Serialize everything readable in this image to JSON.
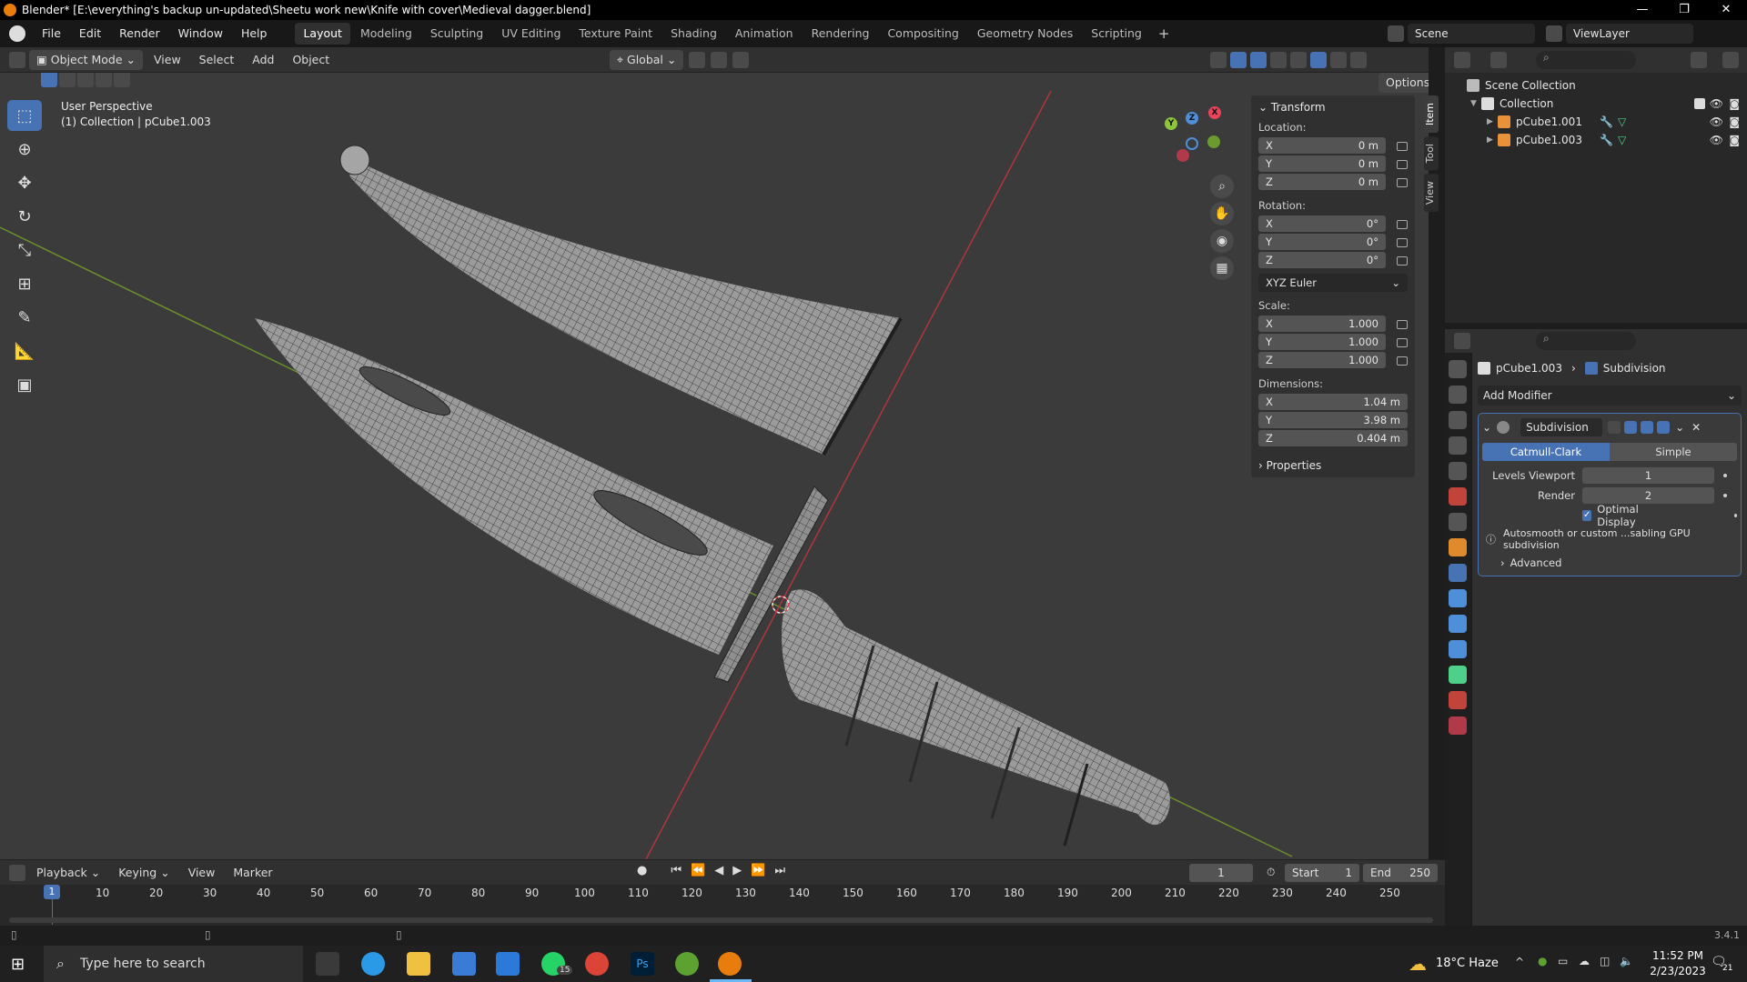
{
  "window": {
    "title": "Blender* [E:\\everything's backup un-updated\\Sheetu work new\\Knife with cover\\Medieval dagger.blend]"
  },
  "menu": [
    "File",
    "Edit",
    "Render",
    "Window",
    "Help"
  ],
  "workspaces": [
    "Layout",
    "Modeling",
    "Sculpting",
    "UV Editing",
    "Texture Paint",
    "Shading",
    "Animation",
    "Rendering",
    "Compositing",
    "Geometry Nodes",
    "Scripting"
  ],
  "active_workspace": "Layout",
  "scene": "Scene",
  "view_layer": "ViewLayer",
  "viewport_header": {
    "mode": "Object Mode",
    "menus": [
      "View",
      "Select",
      "Add",
      "Object"
    ],
    "orientation": "Global",
    "options": "Options"
  },
  "viewport": {
    "perspective": "User Perspective",
    "collection_info": "(1) Collection | pCube1.003"
  },
  "gizmo": {
    "x": "X",
    "y": "Y",
    "z": "Z"
  },
  "npanel": {
    "tabs": [
      "Item",
      "Tool",
      "View"
    ],
    "transform": "Transform",
    "location_label": "Location:",
    "location": [
      {
        "axis": "X",
        "value": "0 m"
      },
      {
        "axis": "Y",
        "value": "0 m"
      },
      {
        "axis": "Z",
        "value": "0 m"
      }
    ],
    "rotation_label": "Rotation:",
    "rotation": [
      {
        "axis": "X",
        "value": "0°"
      },
      {
        "axis": "Y",
        "value": "0°"
      },
      {
        "axis": "Z",
        "value": "0°"
      }
    ],
    "rotation_mode": "XYZ Euler",
    "scale_label": "Scale:",
    "scale": [
      {
        "axis": "X",
        "value": "1.000"
      },
      {
        "axis": "Y",
        "value": "1.000"
      },
      {
        "axis": "Z",
        "value": "1.000"
      }
    ],
    "dimensions_label": "Dimensions:",
    "dimensions": [
      {
        "axis": "X",
        "value": "1.04 m"
      },
      {
        "axis": "Y",
        "value": "3.98 m"
      },
      {
        "axis": "Z",
        "value": "0.404 m"
      }
    ],
    "properties": "Properties"
  },
  "outliner": {
    "scene_collection": "Scene Collection",
    "collection": "Collection",
    "objects": [
      "pCube1.001",
      "pCube1.003"
    ]
  },
  "properties": {
    "object": "pCube1.003",
    "modifier_crumb": "Subdivision",
    "add_modifier": "Add Modifier",
    "modifier_name": "Subdivision",
    "catmull": "Catmull-Clark",
    "simple": "Simple",
    "levels_viewport_label": "Levels Viewport",
    "levels_viewport": "1",
    "render_label": "Render",
    "render": "2",
    "optimal_display": "Optimal Display",
    "info": "Autosmooth or custom ...sabling GPU subdivision",
    "advanced": "Advanced"
  },
  "timeline": {
    "menus": [
      "Playback",
      "Keying",
      "View",
      "Marker"
    ],
    "current_frame": "1",
    "start_label": "Start",
    "start": "1",
    "end_label": "End",
    "end": "250",
    "ticks": [
      "10",
      "20",
      "30",
      "40",
      "50",
      "60",
      "70",
      "80",
      "90",
      "100",
      "110",
      "120",
      "130",
      "140",
      "150",
      "160",
      "170",
      "180",
      "190",
      "200",
      "210",
      "220",
      "230",
      "240",
      "250"
    ],
    "playhead": "1"
  },
  "status": {
    "version": "3.4.1"
  },
  "taskbar": {
    "search_placeholder": "Type here to search",
    "weather": "18°C  Haze",
    "time": "11:52 PM",
    "date": "2/23/2023",
    "notifications": "21",
    "whatsapp_badge": "15"
  }
}
